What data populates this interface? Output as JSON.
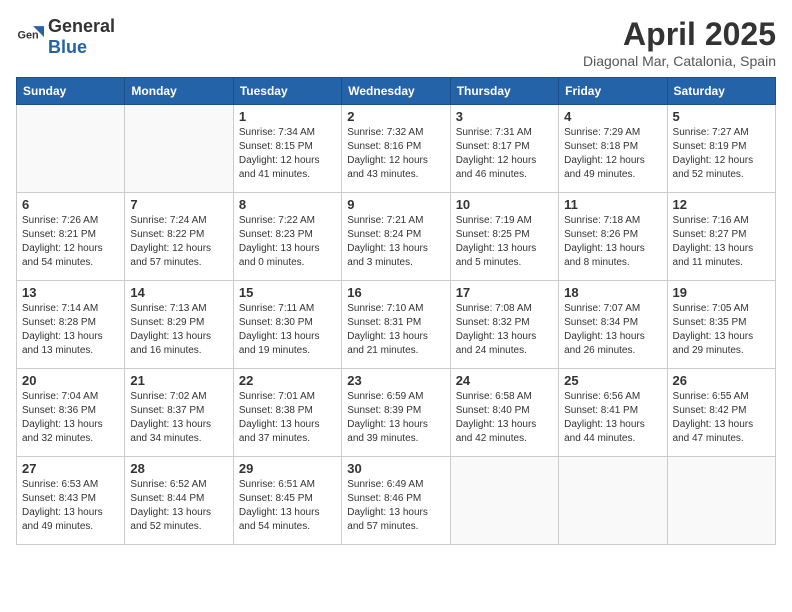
{
  "logo": {
    "general": "General",
    "blue": "Blue"
  },
  "title": "April 2025",
  "subtitle": "Diagonal Mar, Catalonia, Spain",
  "days_of_week": [
    "Sunday",
    "Monday",
    "Tuesday",
    "Wednesday",
    "Thursday",
    "Friday",
    "Saturday"
  ],
  "weeks": [
    [
      {
        "day": "",
        "info": ""
      },
      {
        "day": "",
        "info": ""
      },
      {
        "day": "1",
        "info": "Sunrise: 7:34 AM\nSunset: 8:15 PM\nDaylight: 12 hours and 41 minutes."
      },
      {
        "day": "2",
        "info": "Sunrise: 7:32 AM\nSunset: 8:16 PM\nDaylight: 12 hours and 43 minutes."
      },
      {
        "day": "3",
        "info": "Sunrise: 7:31 AM\nSunset: 8:17 PM\nDaylight: 12 hours and 46 minutes."
      },
      {
        "day": "4",
        "info": "Sunrise: 7:29 AM\nSunset: 8:18 PM\nDaylight: 12 hours and 49 minutes."
      },
      {
        "day": "5",
        "info": "Sunrise: 7:27 AM\nSunset: 8:19 PM\nDaylight: 12 hours and 52 minutes."
      }
    ],
    [
      {
        "day": "6",
        "info": "Sunrise: 7:26 AM\nSunset: 8:21 PM\nDaylight: 12 hours and 54 minutes."
      },
      {
        "day": "7",
        "info": "Sunrise: 7:24 AM\nSunset: 8:22 PM\nDaylight: 12 hours and 57 minutes."
      },
      {
        "day": "8",
        "info": "Sunrise: 7:22 AM\nSunset: 8:23 PM\nDaylight: 13 hours and 0 minutes."
      },
      {
        "day": "9",
        "info": "Sunrise: 7:21 AM\nSunset: 8:24 PM\nDaylight: 13 hours and 3 minutes."
      },
      {
        "day": "10",
        "info": "Sunrise: 7:19 AM\nSunset: 8:25 PM\nDaylight: 13 hours and 5 minutes."
      },
      {
        "day": "11",
        "info": "Sunrise: 7:18 AM\nSunset: 8:26 PM\nDaylight: 13 hours and 8 minutes."
      },
      {
        "day": "12",
        "info": "Sunrise: 7:16 AM\nSunset: 8:27 PM\nDaylight: 13 hours and 11 minutes."
      }
    ],
    [
      {
        "day": "13",
        "info": "Sunrise: 7:14 AM\nSunset: 8:28 PM\nDaylight: 13 hours and 13 minutes."
      },
      {
        "day": "14",
        "info": "Sunrise: 7:13 AM\nSunset: 8:29 PM\nDaylight: 13 hours and 16 minutes."
      },
      {
        "day": "15",
        "info": "Sunrise: 7:11 AM\nSunset: 8:30 PM\nDaylight: 13 hours and 19 minutes."
      },
      {
        "day": "16",
        "info": "Sunrise: 7:10 AM\nSunset: 8:31 PM\nDaylight: 13 hours and 21 minutes."
      },
      {
        "day": "17",
        "info": "Sunrise: 7:08 AM\nSunset: 8:32 PM\nDaylight: 13 hours and 24 minutes."
      },
      {
        "day": "18",
        "info": "Sunrise: 7:07 AM\nSunset: 8:34 PM\nDaylight: 13 hours and 26 minutes."
      },
      {
        "day": "19",
        "info": "Sunrise: 7:05 AM\nSunset: 8:35 PM\nDaylight: 13 hours and 29 minutes."
      }
    ],
    [
      {
        "day": "20",
        "info": "Sunrise: 7:04 AM\nSunset: 8:36 PM\nDaylight: 13 hours and 32 minutes."
      },
      {
        "day": "21",
        "info": "Sunrise: 7:02 AM\nSunset: 8:37 PM\nDaylight: 13 hours and 34 minutes."
      },
      {
        "day": "22",
        "info": "Sunrise: 7:01 AM\nSunset: 8:38 PM\nDaylight: 13 hours and 37 minutes."
      },
      {
        "day": "23",
        "info": "Sunrise: 6:59 AM\nSunset: 8:39 PM\nDaylight: 13 hours and 39 minutes."
      },
      {
        "day": "24",
        "info": "Sunrise: 6:58 AM\nSunset: 8:40 PM\nDaylight: 13 hours and 42 minutes."
      },
      {
        "day": "25",
        "info": "Sunrise: 6:56 AM\nSunset: 8:41 PM\nDaylight: 13 hours and 44 minutes."
      },
      {
        "day": "26",
        "info": "Sunrise: 6:55 AM\nSunset: 8:42 PM\nDaylight: 13 hours and 47 minutes."
      }
    ],
    [
      {
        "day": "27",
        "info": "Sunrise: 6:53 AM\nSunset: 8:43 PM\nDaylight: 13 hours and 49 minutes."
      },
      {
        "day": "28",
        "info": "Sunrise: 6:52 AM\nSunset: 8:44 PM\nDaylight: 13 hours and 52 minutes."
      },
      {
        "day": "29",
        "info": "Sunrise: 6:51 AM\nSunset: 8:45 PM\nDaylight: 13 hours and 54 minutes."
      },
      {
        "day": "30",
        "info": "Sunrise: 6:49 AM\nSunset: 8:46 PM\nDaylight: 13 hours and 57 minutes."
      },
      {
        "day": "",
        "info": ""
      },
      {
        "day": "",
        "info": ""
      },
      {
        "day": "",
        "info": ""
      }
    ]
  ]
}
